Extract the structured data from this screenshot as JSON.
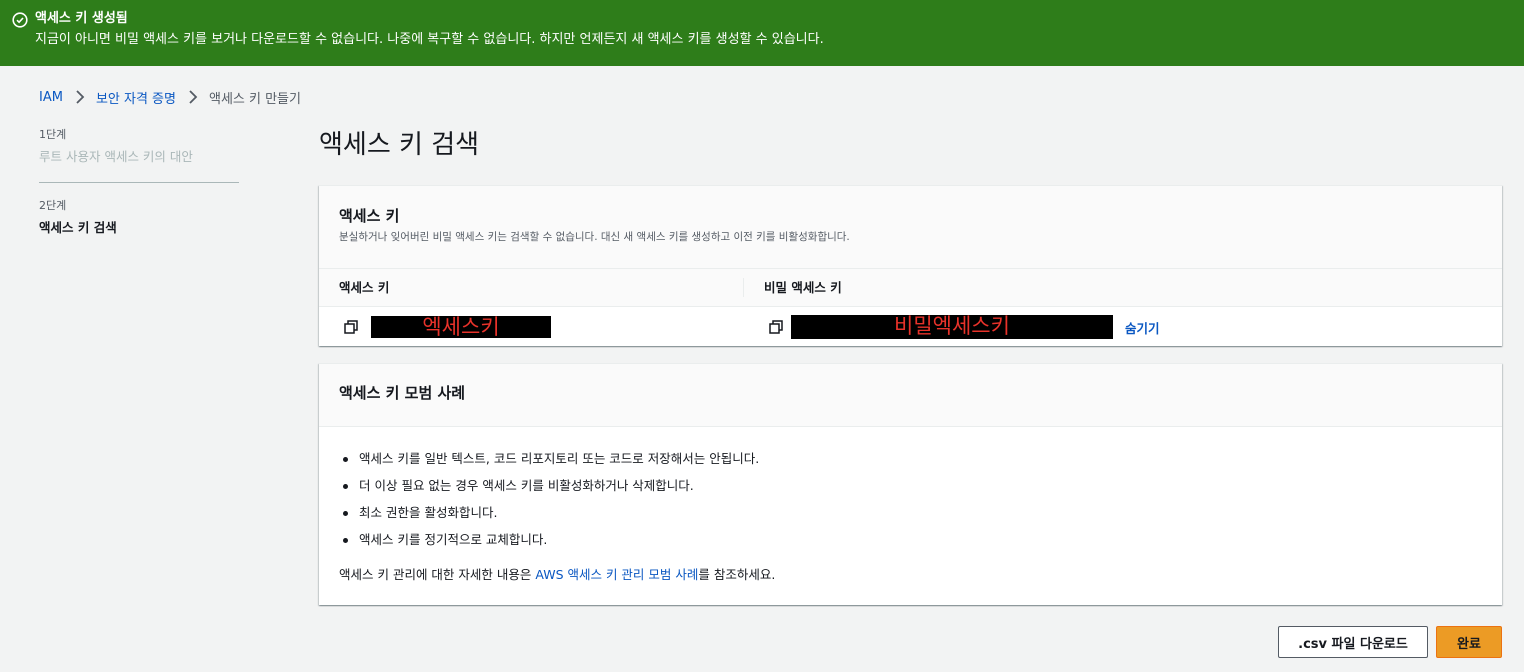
{
  "flash": {
    "icon": "check-circle-icon",
    "color": "#2e7d1a",
    "title": "액세스 키 생성됨",
    "message": "지금이 아니면 비밀 액세스 키를 보거나 다운로드할 수 없습니다. 나중에 복구할 수 없습니다. 하지만 언제든지 새 액세스 키를 생성할 수 있습니다."
  },
  "breadcrumb": {
    "items": [
      "IAM",
      "보안 자격 증명",
      "액세스 키 만들기"
    ]
  },
  "steps": [
    {
      "number": "1단계",
      "label": "루트 사용자 액세스 키의 대안"
    },
    {
      "number": "2단계",
      "label": "액세스 키 검색"
    }
  ],
  "page_title": "액세스 키 검색",
  "access_keys_panel": {
    "title": "액세스 키",
    "description": "분실하거나 잊어버린 비밀 액세스 키는 검색할 수 없습니다. 대신 새 액세스 키를 생성하고 이전 키를 비활성화합니다.",
    "columns": [
      "액세스 키",
      "비밀 액세스 키"
    ],
    "access_key_value": "엑세스키",
    "secret_key_value": "비밀엑세스키",
    "hide_label": "숨기기"
  },
  "best_practices_panel": {
    "title": "액세스 키 모범 사례",
    "items": [
      "액세스 키를 일반 텍스트, 코드 리포지토리 또는 코드로 저장해서는 안됩니다.",
      "더 이상 필요 없는 경우 액세스 키를 비활성화하거나 삭제합니다.",
      "최소 권한을 활성화합니다.",
      "액세스 키를 정기적으로 교체합니다."
    ],
    "footer_prefix": "액세스 키 관리에 대한 자세한 내용은 ",
    "footer_link": "AWS 액세스 키 관리 모범 사례",
    "footer_suffix": "를 참조하세요."
  },
  "buttons": {
    "download_csv": ".csv 파일 다운로드",
    "done": "완료"
  },
  "colors": {
    "primary_button": "#ec9b25",
    "link": "#0a57c2",
    "success": "#2e7d1a"
  }
}
